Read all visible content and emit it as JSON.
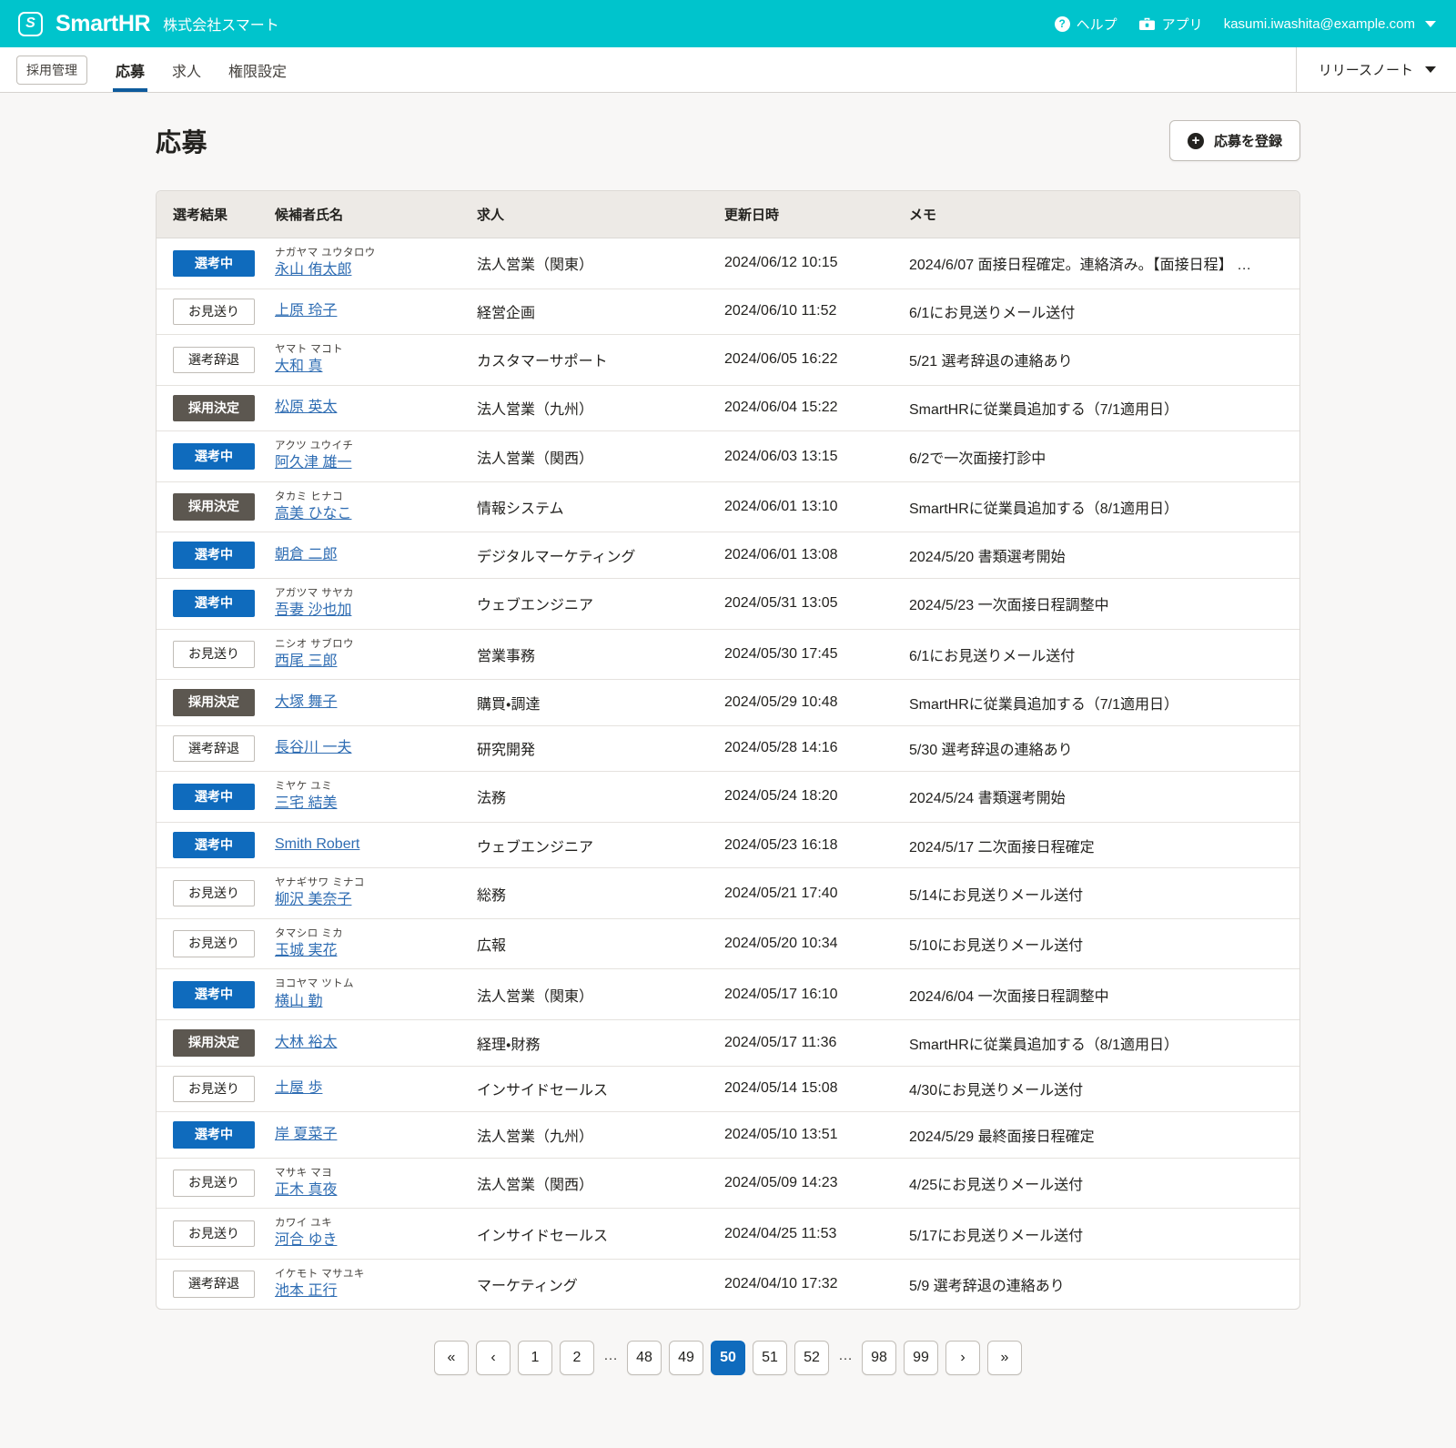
{
  "header": {
    "logo_word": "SmartHR",
    "logo_mark_glyph": "S",
    "tenant_name": "株式会社スマート",
    "help_label": "ヘルプ",
    "apps_label": "アプリ",
    "account_email": "kasumi.iwashita@example.com",
    "brand_color": "#00c4cc"
  },
  "tabbar": {
    "app_chip": "採用管理",
    "tabs": [
      {
        "label": "応募",
        "active": true
      },
      {
        "label": "求人",
        "active": false
      },
      {
        "label": "権限設定",
        "active": false
      }
    ],
    "release_note": "リリースノート",
    "active_underline_color": "#0e5b9c"
  },
  "main": {
    "page_title": "応募",
    "register_button": "応募を登録"
  },
  "table": {
    "columns": [
      "選考結果",
      "候補者氏名",
      "求人",
      "更新日時",
      "メモ"
    ],
    "status_colors": {
      "選考中": "#0f6bbd",
      "採用決定": "#5c5750",
      "お見送り": "#ffffff",
      "選考辞退": "#ffffff"
    },
    "rows": [
      {
        "status": "選考中",
        "status_style": "blue",
        "kana": "ナガヤマ ユウタロウ",
        "name": "永山 侑太郎",
        "job": "法人営業（関東）",
        "updated": "2024/06/12 10:15",
        "memo": "2024/6/07 面接日程確定。連絡済み。【面接日程】 …"
      },
      {
        "status": "お見送り",
        "status_style": "plain",
        "kana": "",
        "name": "上原 玲子",
        "job": "経営企画",
        "updated": "2024/06/10 11:52",
        "memo": "6/1にお見送りメール送付"
      },
      {
        "status": "選考辞退",
        "status_style": "plain",
        "kana": "ヤマト マコト",
        "name": "大和 真",
        "job": "カスタマーサポート",
        "updated": "2024/06/05 16:22",
        "memo": "5/21 選考辞退の連絡あり"
      },
      {
        "status": "採用決定",
        "status_style": "dark",
        "kana": "",
        "name": "松原 英太",
        "job": "法人営業（九州）",
        "updated": "2024/06/04 15:22",
        "memo": "SmartHRに従業員追加する（7/1適用日）"
      },
      {
        "status": "選考中",
        "status_style": "blue",
        "kana": "アクツ ユウイチ",
        "name": "阿久津 雄一",
        "job": "法人営業（関西）",
        "updated": "2024/06/03 13:15",
        "memo": "6/2で一次面接打診中"
      },
      {
        "status": "採用決定",
        "status_style": "dark",
        "kana": "タカミ ヒナコ",
        "name": "高美 ひなこ",
        "job": "情報システム",
        "updated": "2024/06/01 13:10",
        "memo": "SmartHRに従業員追加する（8/1適用日）"
      },
      {
        "status": "選考中",
        "status_style": "blue",
        "kana": "",
        "name": "朝倉 二郎",
        "job": "デジタルマーケティング",
        "updated": "2024/06/01 13:08",
        "memo": "2024/5/20 書類選考開始"
      },
      {
        "status": "選考中",
        "status_style": "blue",
        "kana": "アガツマ サヤカ",
        "name": "吾妻 沙也加",
        "job": "ウェブエンジニア",
        "updated": "2024/05/31 13:05",
        "memo": "2024/5/23 一次面接日程調整中"
      },
      {
        "status": "お見送り",
        "status_style": "plain",
        "kana": "ニシオ サブロウ",
        "name": "西尾 三郎",
        "job": "営業事務",
        "updated": "2024/05/30 17:45",
        "memo": "6/1にお見送りメール送付"
      },
      {
        "status": "採用決定",
        "status_style": "dark",
        "kana": "",
        "name": "大塚 舞子",
        "job": "購買・調達",
        "updated": "2024/05/29 10:48",
        "memo": "SmartHRに従業員追加する（7/1適用日）"
      },
      {
        "status": "選考辞退",
        "status_style": "plain",
        "kana": "",
        "name": "長谷川 一夫",
        "job": "研究開発",
        "updated": "2024/05/28 14:16",
        "memo": "5/30 選考辞退の連絡あり"
      },
      {
        "status": "選考中",
        "status_style": "blue",
        "kana": "ミヤケ ユミ",
        "name": "三宅 結美",
        "job": "法務",
        "updated": "2024/05/24 18:20",
        "memo": "2024/5/24 書類選考開始"
      },
      {
        "status": "選考中",
        "status_style": "blue",
        "kana": "",
        "name": "Smith Robert",
        "job": "ウェブエンジニア",
        "updated": "2024/05/23 16:18",
        "memo": "2024/5/17 二次面接日程確定"
      },
      {
        "status": "お見送り",
        "status_style": "plain",
        "kana": "ヤナギサワ ミナコ",
        "name": "柳沢 美奈子",
        "job": "総務",
        "updated": "2024/05/21 17:40",
        "memo": "5/14にお見送りメール送付"
      },
      {
        "status": "お見送り",
        "status_style": "plain",
        "kana": "タマシロ ミカ",
        "name": "玉城 実花",
        "job": "広報",
        "updated": "2024/05/20 10:34",
        "memo": "5/10にお見送りメール送付"
      },
      {
        "status": "選考中",
        "status_style": "blue",
        "kana": "ヨコヤマ ツトム",
        "name": "横山 勤",
        "job": "法人営業（関東）",
        "updated": "2024/05/17 16:10",
        "memo": "2024/6/04 一次面接日程調整中"
      },
      {
        "status": "採用決定",
        "status_style": "dark",
        "kana": "",
        "name": "大林 裕太",
        "job": "経理・財務",
        "updated": "2024/05/17 11:36",
        "memo": "SmartHRに従業員追加する（8/1適用日）"
      },
      {
        "status": "お見送り",
        "status_style": "plain",
        "kana": "",
        "name": "土屋 歩",
        "job": "インサイドセールス",
        "updated": "2024/05/14 15:08",
        "memo": "4/30にお見送りメール送付"
      },
      {
        "status": "選考中",
        "status_style": "blue",
        "kana": "",
        "name": "岸 夏菜子",
        "job": "法人営業（九州）",
        "updated": "2024/05/10 13:51",
        "memo": "2024/5/29 最終面接日程確定"
      },
      {
        "status": "お見送り",
        "status_style": "plain",
        "kana": "マサキ マヨ",
        "name": "正木 真夜",
        "job": "法人営業（関西）",
        "updated": "2024/05/09 14:23",
        "memo": "4/25にお見送りメール送付"
      },
      {
        "status": "お見送り",
        "status_style": "plain",
        "kana": "カワイ ユキ",
        "name": "河合 ゆき",
        "job": "インサイドセールス",
        "updated": "2024/04/25 11:53",
        "memo": "5/17にお見送りメール送付"
      },
      {
        "status": "選考辞退",
        "status_style": "plain",
        "kana": "イケモト マサユキ",
        "name": "池本 正行",
        "job": "マーケティング",
        "updated": "2024/04/10 17:32",
        "memo": "5/9 選考辞退の連絡あり"
      }
    ]
  },
  "pagination": {
    "first_label": "«",
    "prev_label": "‹",
    "next_label": "›",
    "last_label": "»",
    "ellipsis": "…",
    "current_page": 50,
    "items": [
      {
        "type": "nav",
        "label": "«"
      },
      {
        "type": "nav",
        "label": "‹"
      },
      {
        "type": "page",
        "label": "1"
      },
      {
        "type": "page",
        "label": "2"
      },
      {
        "type": "gap",
        "label": "…"
      },
      {
        "type": "page",
        "label": "48"
      },
      {
        "type": "page",
        "label": "49"
      },
      {
        "type": "page",
        "label": "50",
        "current": true
      },
      {
        "type": "page",
        "label": "51"
      },
      {
        "type": "page",
        "label": "52"
      },
      {
        "type": "gap",
        "label": "…"
      },
      {
        "type": "page",
        "label": "98"
      },
      {
        "type": "page",
        "label": "99"
      },
      {
        "type": "nav",
        "label": "›"
      },
      {
        "type": "nav",
        "label": "»"
      }
    ]
  }
}
